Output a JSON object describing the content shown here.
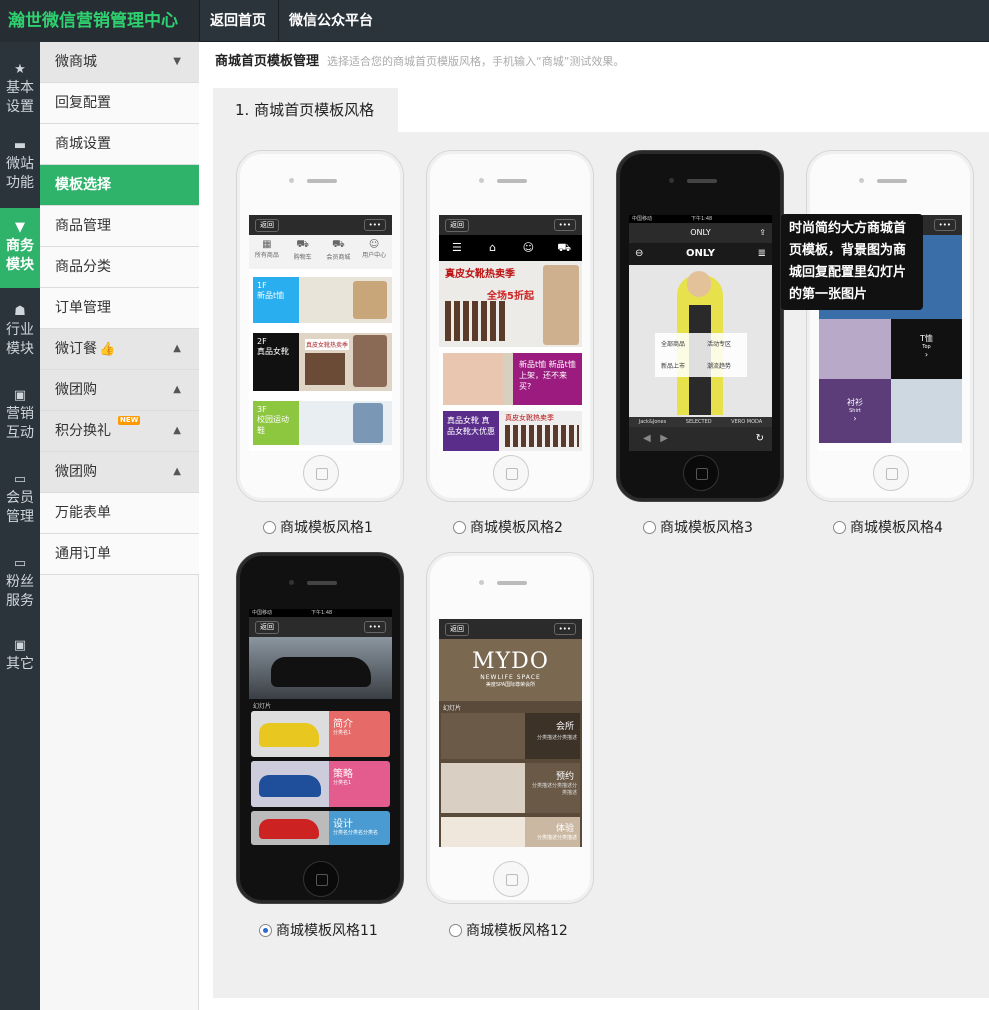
{
  "brand": "瀚世微信营销管理中心",
  "topnav": [
    "返回首页",
    "微信公众平台"
  ],
  "categories": [
    {
      "icon": "star-icon",
      "label": "基本设置"
    },
    {
      "icon": "briefcase-icon",
      "label": "微站功能"
    },
    {
      "icon": "cart-icon",
      "label": "商务模块",
      "active": true
    },
    {
      "icon": "sitemap-icon",
      "label": "行业模块"
    },
    {
      "icon": "gift-icon",
      "label": "营销互动"
    },
    {
      "icon": "card-icon",
      "label": "会员管理"
    },
    {
      "icon": "card-icon",
      "label": "粉丝服务"
    },
    {
      "icon": "gift-icon",
      "label": "其它"
    }
  ],
  "submenu": [
    {
      "label": "微商城",
      "group": true
    },
    {
      "label": "回复配置"
    },
    {
      "label": "商城设置"
    },
    {
      "label": "模板选择",
      "active": true
    },
    {
      "label": "商品管理"
    },
    {
      "label": "商品分类"
    },
    {
      "label": "订单管理"
    },
    {
      "label": "微订餐",
      "group": true,
      "thumb": true
    },
    {
      "label": "微团购",
      "group": true
    },
    {
      "label": "积分换礼",
      "group": true,
      "badge": "NEW"
    },
    {
      "label": "微团购",
      "group": true
    },
    {
      "label": "万能表单"
    },
    {
      "label": "通用订单"
    }
  ],
  "page": {
    "title": "商城首页模板管理",
    "hint": "选择适合您的商城首页模版风格，手机输入“商城”测试效果。",
    "tab": "1. 商城首页模板风格"
  },
  "templates": [
    {
      "label": "商城模板风格1",
      "selected": false,
      "phone": "white"
    },
    {
      "label": "商城模板风格2",
      "selected": false,
      "phone": "white"
    },
    {
      "label": "商城模板风格3",
      "selected": false,
      "phone": "black"
    },
    {
      "label": "商城模板风格4",
      "selected": false,
      "phone": "white"
    },
    {
      "label": "商城模板风格11",
      "selected": true,
      "phone": "black"
    },
    {
      "label": "商城模板风格12",
      "selected": false,
      "phone": "white"
    }
  ],
  "tooltip": "时尚简约大方商城首页模板，背景图为商城回复配置里幻灯片的第一张图片",
  "screens": {
    "s1": {
      "back": "返回",
      "nav": [
        "所有商品",
        "购物车",
        "会员商城",
        "用户中心"
      ],
      "floors": [
        "1F",
        "2F",
        "3F"
      ],
      "floor_labels": [
        "新品t恤",
        "真品女靴",
        "校园运动鞋"
      ],
      "banner": "真皮女靴热卖季"
    },
    "s2": {
      "back": "返回",
      "banner": "真皮女靴热卖季",
      "promo": "全场5折起",
      "tile1": "新品t恤 新品t恤上架，还不来买?",
      "tile2": "真品女靴 真品女靴大优惠",
      "tile3": "真皮女靴热卖季"
    },
    "s3": {
      "status": "中国移动",
      "time": "下午1:48",
      "title": "ONLY",
      "brand": "ONLY",
      "menu": [
        "全部商品",
        "活动专区",
        "新品上市",
        "潮流趋势"
      ],
      "brands": [
        "Jack&Jones",
        "SELECTED",
        "VERO MODA"
      ]
    },
    "s4": {
      "back": "返回",
      "tiles": [
        "T恤",
        "Top",
        "衬衫",
        "Shirt"
      ]
    },
    "s11": {
      "status": "中国移动",
      "time": "下午1:48",
      "back": "返回",
      "caption": "幻灯片",
      "items": [
        {
          "title": "简介",
          "sub": "分类名1"
        },
        {
          "title": "策略",
          "sub": "分类名1"
        },
        {
          "title": "设计",
          "sub": "分类名分类名分类名"
        }
      ]
    },
    "s12": {
      "back": "返回",
      "logo": "MYDO",
      "logo_sub": "NEWLIFE SPACE",
      "logo_sub2": "美度SPA国际尊荣会所",
      "caption": "幻灯片",
      "items": [
        {
          "title": "会所",
          "sub": "分类描述分类描述"
        },
        {
          "title": "预约",
          "sub": "分类描述分类描述分类描述"
        },
        {
          "title": "体验",
          "sub": "分类描述分类描述"
        }
      ]
    }
  }
}
